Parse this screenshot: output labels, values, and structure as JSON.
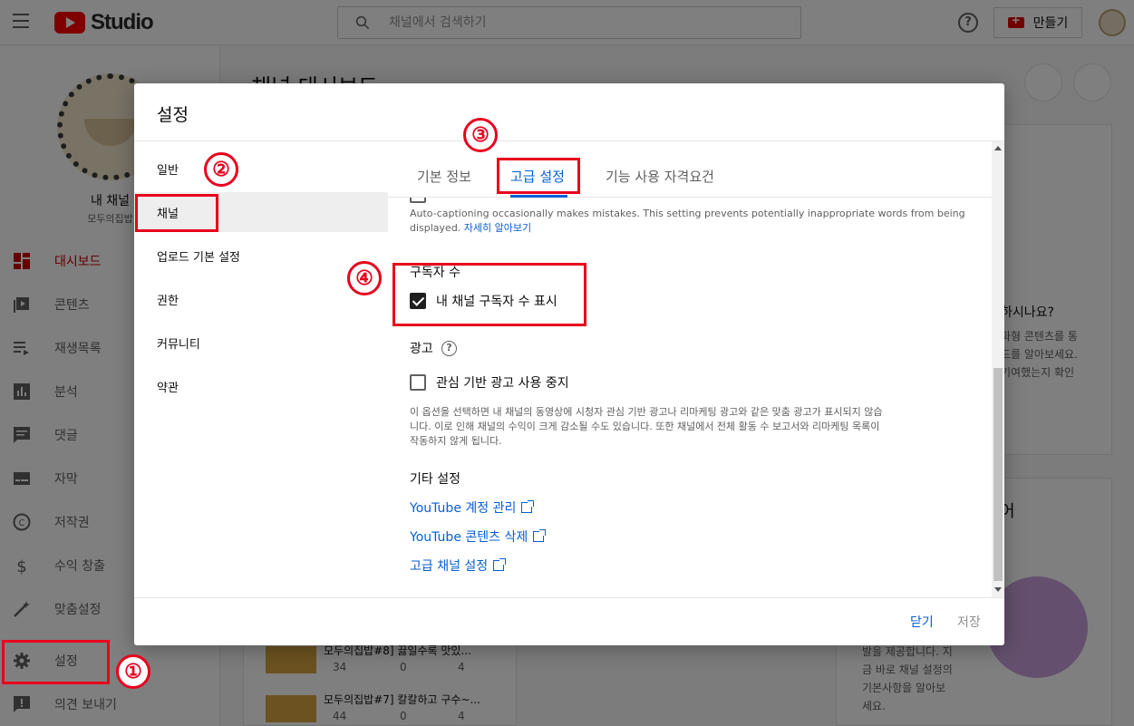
{
  "app": {
    "logo_text": "Studio",
    "search_placeholder": "채널에서 검색하기",
    "help_glyph": "?",
    "create_label": "만들기"
  },
  "sidebar": {
    "channel_name": "내 채널",
    "channel_sub": "모두의집밥",
    "items": [
      {
        "label": "대시보드",
        "icon": "dashboard-icon"
      },
      {
        "label": "콘텐츠",
        "icon": "content-icon"
      },
      {
        "label": "재생목록",
        "icon": "playlist-icon"
      },
      {
        "label": "분석",
        "icon": "analytics-icon"
      },
      {
        "label": "댓글",
        "icon": "comments-icon"
      },
      {
        "label": "자막",
        "icon": "subtitles-icon"
      },
      {
        "label": "저작권",
        "icon": "copyright-icon"
      },
      {
        "label": "수익 창출",
        "icon": "monetization-icon"
      },
      {
        "label": "맞춤설정",
        "icon": "customization-icon"
      },
      {
        "label": "설정",
        "icon": "gear-icon"
      },
      {
        "label": "의견 보내기",
        "icon": "feedback-icon"
      }
    ]
  },
  "background": {
    "page_title": "채널 대시보드",
    "right_card_text_1": "하시나요?",
    "right_card_text_2": "화형 콘텐츠를 통",
    "right_card_text_3": "드를 알아보세요.",
    "right_card_text_4": "기여했는지 확인",
    "right_card2_text_1": "발을 제공합니다. 지",
    "right_card2_text_2": "금 바로 채널 설정의",
    "right_card2_text_3": "기본사항을 알아보",
    "right_card2_text_4": "세요.",
    "right_card2_heading": "어",
    "video1_title": "모두의집밥#8] 끓일수록 맛있...",
    "video1_views": "34",
    "video1_comments": "0",
    "video1_likes": "4",
    "video2_title": "모두의집밥#7] 칼칼하고 구수~...",
    "video2_views": "44",
    "video2_comments": "0",
    "video2_likes": "4"
  },
  "dialog": {
    "title": "설정",
    "left_items": [
      "일반",
      "채널",
      "업로드 기본 설정",
      "권한",
      "커뮤니티",
      "약관"
    ],
    "tabs": [
      "기본 정보",
      "고급 설정",
      "기능 사용 자격요건"
    ],
    "auto_caption_text": "Auto-captioning occasionally makes mistakes. This setting prevents potentially inappropriate words from being displayed.",
    "auto_caption_link": "자세히 알아보기",
    "subscriber_section": "구독자 수",
    "subscriber_checkbox": "내 채널 구독자 수 표시",
    "ads_section": "광고",
    "ads_info_glyph": "?",
    "ads_checkbox": "관심 기반 광고 사용 중지",
    "ads_desc_1": "이 옵션을 선택하면 내 채널의 동영상에 시청자 관심 기반 광고나 리마케팅 광고와 같은 맞춤 광고가 표시되지 않습",
    "ads_desc_2": "니다. 이로 인해 채널의 수익이 크게 감소될 수도 있습니다. 또한 채널에서 전체 활동 수 보고서와 리마케팅 목록이",
    "ads_desc_3": "작동하지 않게 됩니다.",
    "other_section": "기타 설정",
    "links": [
      "YouTube 계정 관리",
      "YouTube 콘텐츠 삭제",
      "고급 채널 설정"
    ],
    "close_label": "닫기",
    "save_label": "저장"
  },
  "annotations": [
    "①",
    "②",
    "③",
    "④"
  ],
  "colors": {
    "accent_red": "#cc0000",
    "link_blue": "#065fd4",
    "annotation_red": "#e8001c"
  }
}
